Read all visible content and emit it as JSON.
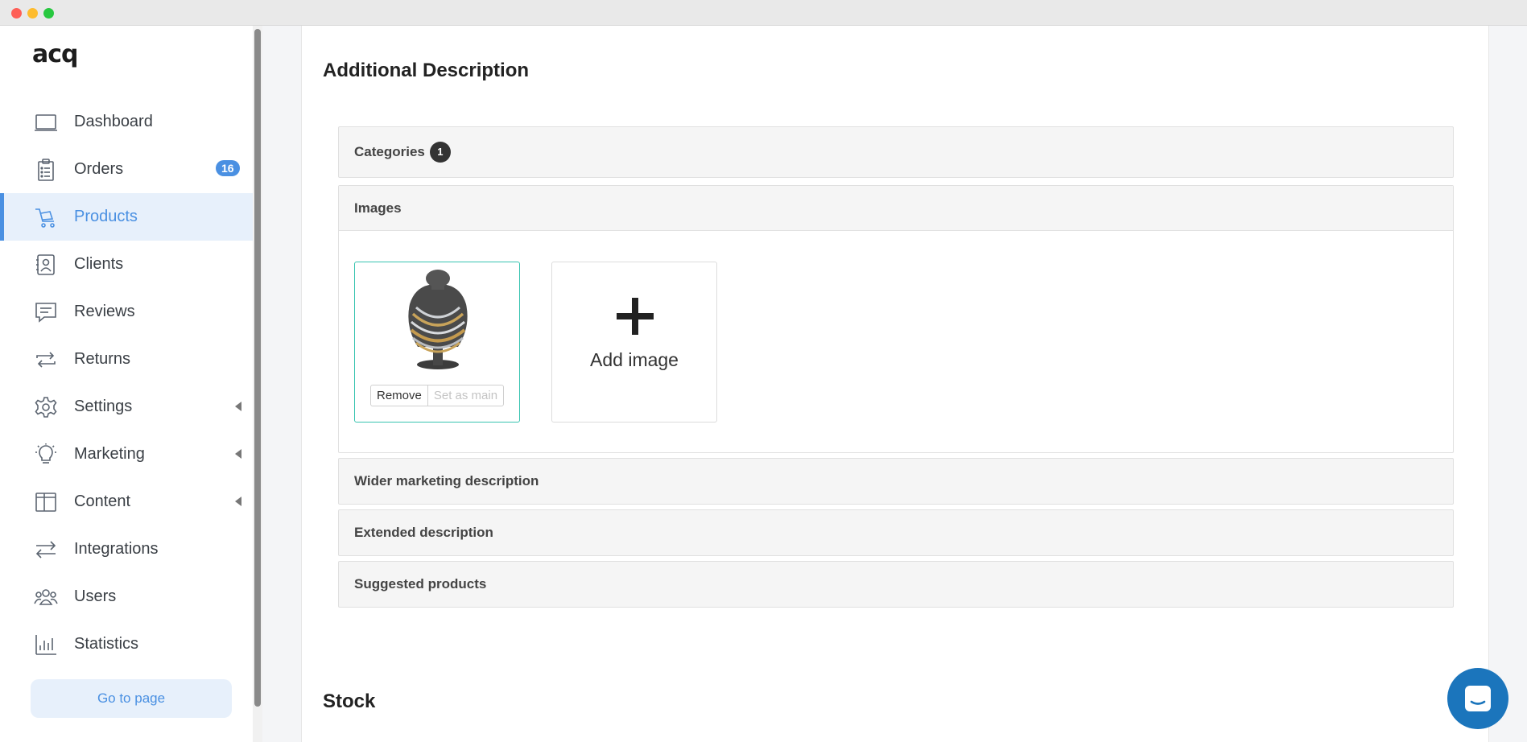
{
  "sidebar": {
    "logo": "acq",
    "items": [
      {
        "label": "Dashboard",
        "icon": "monitor-icon"
      },
      {
        "label": "Orders",
        "icon": "clipboard-icon",
        "badge": "16"
      },
      {
        "label": "Products",
        "icon": "cart-icon",
        "active": true
      },
      {
        "label": "Clients",
        "icon": "contact-card-icon"
      },
      {
        "label": "Reviews",
        "icon": "chat-bubble-icon"
      },
      {
        "label": "Returns",
        "icon": "return-arrows-icon"
      },
      {
        "label": "Settings",
        "icon": "gear-icon",
        "expandable": true
      },
      {
        "label": "Marketing",
        "icon": "lightbulb-icon",
        "expandable": true
      },
      {
        "label": "Content",
        "icon": "layout-columns-icon",
        "expandable": true
      },
      {
        "label": "Integrations",
        "icon": "swap-arrows-icon"
      },
      {
        "label": "Users",
        "icon": "users-icon"
      },
      {
        "label": "Statistics",
        "icon": "bar-chart-icon"
      }
    ],
    "goto_label": "Go to page"
  },
  "main": {
    "section_title": "Additional Description",
    "categories": {
      "label": "Categories",
      "count": "1"
    },
    "images": {
      "label": "Images",
      "remove_label": "Remove",
      "set_main_label": "Set as main",
      "add_label": "Add image"
    },
    "panels": [
      {
        "label": "Wider marketing description"
      },
      {
        "label": "Extended description"
      },
      {
        "label": "Suggested products"
      }
    ],
    "stock_title": "Stock"
  },
  "colors": {
    "accent": "#4a90e2",
    "active_bg": "#e7f0fb",
    "image_border": "#38c4b0",
    "chat_button": "#1b75bc"
  }
}
